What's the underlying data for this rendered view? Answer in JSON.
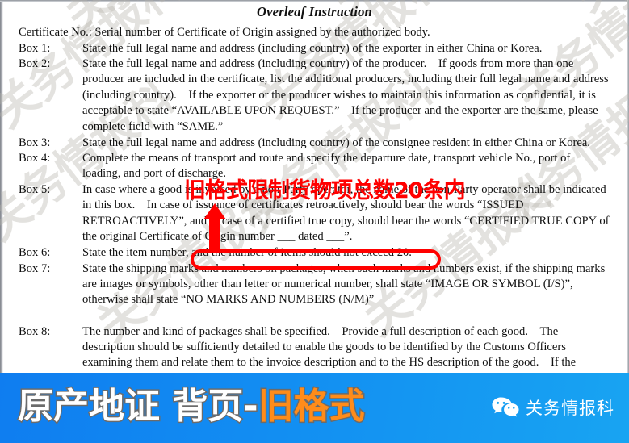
{
  "document": {
    "title": "Overleaf Instruction",
    "watermark_text": "关务情报科",
    "lines": [
      {
        "label": "",
        "text": "Certificate No.: Serial number of Certificate of Origin assigned by the authorized body."
      },
      {
        "label": "Box 1:",
        "text": "State the full legal name and address (including country) of the exporter in either China or Korea."
      },
      {
        "label": "Box 2:",
        "text": "State the full legal name and address (including country) of the producer. If goods from more than one producer are included in the certificate, list the additional producers, including their full legal name and address (including country). If the exporter or the producer wishes to maintain this information as confidential, it is acceptable to state “AVAILABLE UPON REQUEST.” If the producer and the exporter are the same, please complete field with “SAME.”"
      },
      {
        "label": "Box 3:",
        "text": "State the full legal name and address (including country) of the consignee resident in either China or Korea."
      },
      {
        "label": "Box 4:",
        "text": "Complete the means of transport and route and specify the departure date, transport vehicle No., port of loading, and port of discharge."
      },
      {
        "label": "Box 5:",
        "text": "In case where a good is invoiced by a non-Party operator, the name of the non-Party operator shall be indicated in this box. In case of issuance of certificates retroactively, should bear the words “ISSUED RETROACTIVELY”, and in case of a certified true copy, should bear the words “CERTIFIED TRUE COPY of the original Certificate of Origin number ___ dated ___”."
      },
      {
        "label": "Box 6:",
        "text": "State the item number, and the number of items should not exceed 20."
      },
      {
        "label": "Box 7:",
        "text": "State the shipping marks and numbers on packages, when such marks and numbers exist, if the shipping marks are images or symbols, other than letter or numerical number, shall state “IMAGE OR SYMBOL (I/S)”, otherwise shall state “NO MARKS AND NUMBERS (N/M)”"
      },
      {
        "label": "Box 8:",
        "text": "The number and kind of packages shall be specified. Provide a full description of each good. The description should be sufficiently detailed to enable the goods to be identified by the Customs Officers examining them and relate them to the invoice description and to the HS description of the good. If the"
      }
    ]
  },
  "annotation": {
    "note_text": "旧格式限制货物项总数20条内",
    "highlight_target": "and the number of items should not exceed 20.",
    "color": "#ff0000"
  },
  "banner": {
    "title_white": "原产地证 背页-",
    "title_orange": "旧格式",
    "wechat_account": "关务情报科",
    "gradient_start": "#0f7df0",
    "gradient_end": "#18a4f2",
    "orange": "#ff8c1a"
  }
}
